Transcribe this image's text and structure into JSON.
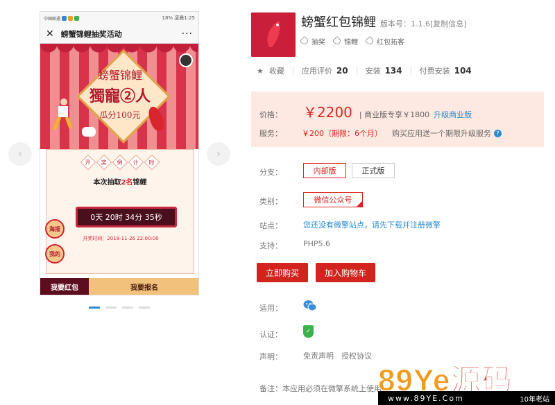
{
  "phone": {
    "carrier": "中国联通",
    "status_right": "18% 凌晨1:25",
    "nav_title": "螃蟹锦鲤抽奖活动",
    "banner": {
      "line1": "螃蟹锦鲤",
      "line2": "獨寵②人",
      "line3": "瓜分100元"
    },
    "card": {
      "head_chars": [
        "开",
        "奖",
        "倒",
        "计",
        "时"
      ],
      "sub_prefix": "本次抽取",
      "sub_count": "2名",
      "sub_suffix": "锦鲤",
      "countdown": "0天 20时 34分 35秒",
      "draw_time": "开奖时间：2018-11-26 22:00:00",
      "bubble_poster": "海报",
      "bubble_mine": "我的"
    },
    "tab_left": "我要红包",
    "tab_right": "我要报名"
  },
  "app": {
    "title": "螃蟹红包锦鲤",
    "version": "版本号：1.1.6[复制信息]",
    "tags": [
      "抽奖",
      "锦鲤",
      "红包拓客"
    ]
  },
  "stats": {
    "fav_label": "收藏",
    "rating_label": "应用评价",
    "rating_value": "20",
    "install_label": "安装",
    "install_value": "134",
    "paid_label": "付费安装",
    "paid_value": "104"
  },
  "price": {
    "price_label": "价格：",
    "price_value": "￥2200",
    "biz_text": "| 商业版专享￥1800",
    "upgrade_link": "升级商业版",
    "service_label": "服务：",
    "service_value": "￥200（期限：6个月）",
    "service_note": "购买应用送一个期限升级服务"
  },
  "details": {
    "branch_label": "分支：",
    "branch_internal": "内部版",
    "branch_official": "正式版",
    "category_label": "类别：",
    "category_value": "微信公众号",
    "site_label": "站点：",
    "site_value": "您还没有微擎站点，请先下载并注册微擎",
    "support_label": "支持：",
    "support_value": "PHP5.6",
    "buy_button": "立即购买",
    "cart_button": "加入购物车",
    "apply_label": "适用：",
    "cert_label": "认证：",
    "statement_label": "声明：",
    "statement_disclaimer": "免责声明",
    "statement_license": "授权协议",
    "note": "备注：本应用必须在微擎系统上使用"
  },
  "watermark": {
    "big_num": "89Ye",
    "big_cn": "源码",
    "url": "www.89YE.Com",
    "years": "10年老站"
  },
  "colors": {
    "accent_red": "#e0211b",
    "link_blue": "#2a8bd0",
    "price_bg": "#fde9e2"
  }
}
